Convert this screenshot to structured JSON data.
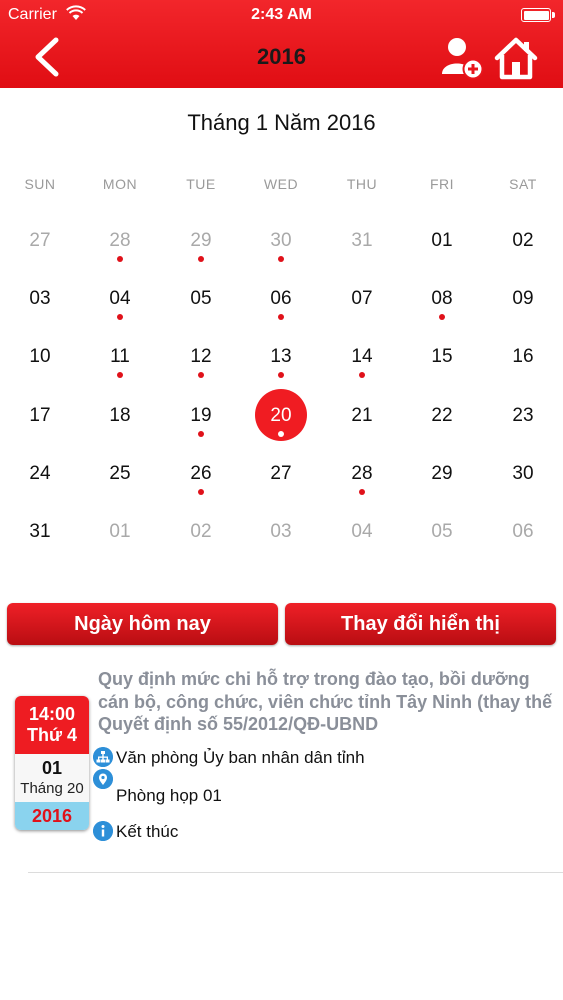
{
  "status_bar": {
    "carrier": "Carrier",
    "time": "2:43 AM"
  },
  "nav": {
    "title": "2016",
    "back_icon": "back-chevron-icon",
    "add_user_icon": "add-user-icon",
    "home_icon": "home-icon"
  },
  "calendar": {
    "month_title": "Tháng 1 Năm 2016",
    "weekdays": [
      "SUN",
      "MON",
      "TUE",
      "WED",
      "THU",
      "FRI",
      "SAT"
    ],
    "selected_day": "20",
    "weeks": [
      [
        {
          "d": "27",
          "muted": true,
          "dot": false
        },
        {
          "d": "28",
          "muted": true,
          "dot": true
        },
        {
          "d": "29",
          "muted": true,
          "dot": true
        },
        {
          "d": "30",
          "muted": true,
          "dot": true
        },
        {
          "d": "31",
          "muted": true,
          "dot": false
        },
        {
          "d": "01",
          "muted": false,
          "dot": false
        },
        {
          "d": "02",
          "muted": false,
          "dot": false
        }
      ],
      [
        {
          "d": "03",
          "muted": false,
          "dot": false
        },
        {
          "d": "04",
          "muted": false,
          "dot": true
        },
        {
          "d": "05",
          "muted": false,
          "dot": false
        },
        {
          "d": "06",
          "muted": false,
          "dot": true
        },
        {
          "d": "07",
          "muted": false,
          "dot": false
        },
        {
          "d": "08",
          "muted": false,
          "dot": true
        },
        {
          "d": "09",
          "muted": false,
          "dot": false
        }
      ],
      [
        {
          "d": "10",
          "muted": false,
          "dot": false
        },
        {
          "d": "11",
          "muted": false,
          "dot": true
        },
        {
          "d": "12",
          "muted": false,
          "dot": true
        },
        {
          "d": "13",
          "muted": false,
          "dot": true
        },
        {
          "d": "14",
          "muted": false,
          "dot": true
        },
        {
          "d": "15",
          "muted": false,
          "dot": false
        },
        {
          "d": "16",
          "muted": false,
          "dot": false
        }
      ],
      [
        {
          "d": "17",
          "muted": false,
          "dot": false
        },
        {
          "d": "18",
          "muted": false,
          "dot": false
        },
        {
          "d": "19",
          "muted": false,
          "dot": true
        },
        {
          "d": "20",
          "muted": false,
          "dot": true,
          "selected": true
        },
        {
          "d": "21",
          "muted": false,
          "dot": false
        },
        {
          "d": "22",
          "muted": false,
          "dot": false
        },
        {
          "d": "23",
          "muted": false,
          "dot": false
        }
      ],
      [
        {
          "d": "24",
          "muted": false,
          "dot": false
        },
        {
          "d": "25",
          "muted": false,
          "dot": false
        },
        {
          "d": "26",
          "muted": false,
          "dot": true
        },
        {
          "d": "27",
          "muted": false,
          "dot": false
        },
        {
          "d": "28",
          "muted": false,
          "dot": true
        },
        {
          "d": "29",
          "muted": false,
          "dot": false
        },
        {
          "d": "30",
          "muted": false,
          "dot": false
        }
      ],
      [
        {
          "d": "31",
          "muted": false,
          "dot": false
        },
        {
          "d": "01",
          "muted": true,
          "dot": false
        },
        {
          "d": "02",
          "muted": true,
          "dot": false
        },
        {
          "d": "03",
          "muted": true,
          "dot": false
        },
        {
          "d": "04",
          "muted": true,
          "dot": false
        },
        {
          "d": "05",
          "muted": true,
          "dot": false
        },
        {
          "d": "06",
          "muted": true,
          "dot": false
        }
      ]
    ]
  },
  "buttons": {
    "today": "Ngày hôm nay",
    "change_view": "Thay đổi hiển thị"
  },
  "event": {
    "title": "Quy định mức chi hỗ trợ trong đào tạo, bồi dưỡng cán bộ, công chức, viên chức tỉnh Tây Ninh (thay thế Quyết định số 55/2012/QĐ-UBND",
    "time": "14:00",
    "weekday": "Thứ 4",
    "day": "01",
    "month": "Tháng 20",
    "year": "2016",
    "organization": "Văn phòng Ủy ban nhân dân tỉnh",
    "location": "Phòng họp 01",
    "status": "Kết thúc"
  },
  "colors": {
    "primary": "#ee1c22",
    "event_dot": "#e0111a",
    "muted_text": "#a9a9a9",
    "info_icon": "#2d8fd8",
    "year_band": "#8ad3ee"
  }
}
